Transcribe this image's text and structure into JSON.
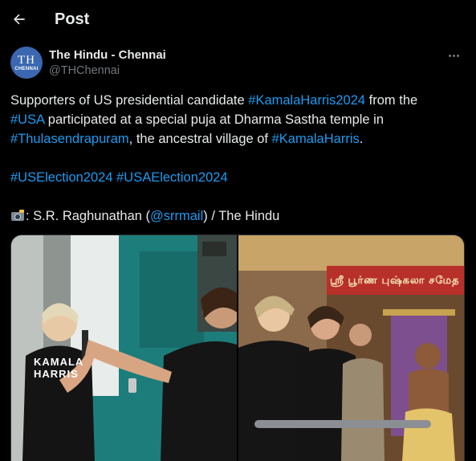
{
  "header": {
    "title": "Post"
  },
  "author": {
    "display_name": "The Hindu - Chennai",
    "handle": "@THChennai",
    "avatar_text": "TH",
    "avatar_subtext": "CHENNAI"
  },
  "tweet": {
    "line1_pre": "Supporters of US presidential candidate ",
    "line1_tag": "#KamalaHarris2024",
    "line1_post": " from the",
    "line2_tag": "#USA",
    "line2_post": " participated at a special puja at Dharma Sastha temple in",
    "line3_tag": "#Thulasendrapuram",
    "line3_mid": ", the ancestral village of ",
    "line3_tag2": "#KamalaHarris",
    "line3_post": ".",
    "hashtag1": "#USElection2024",
    "hashtag2": "#USAElection2024",
    "credit_pre": ": S.R. Raghunathan (",
    "credit_mention": "@srrmail",
    "credit_post": ") / The Hindu"
  },
  "media": {
    "photo1_shirt_text": "KAMALA HARRIS",
    "photo2_sign_text": "ஸ்ரீ பூர்ண புஷ்கலா சமேத"
  },
  "colors": {
    "background": "#000000",
    "text": "#e7e9ea",
    "muted": "#71767b",
    "link": "#1d9bf0",
    "avatar_bg": "#3a67b0"
  },
  "icons": {
    "back": "arrow-left-icon",
    "more": "more-horizontal-icon",
    "credit": "camera-flash-icon"
  }
}
